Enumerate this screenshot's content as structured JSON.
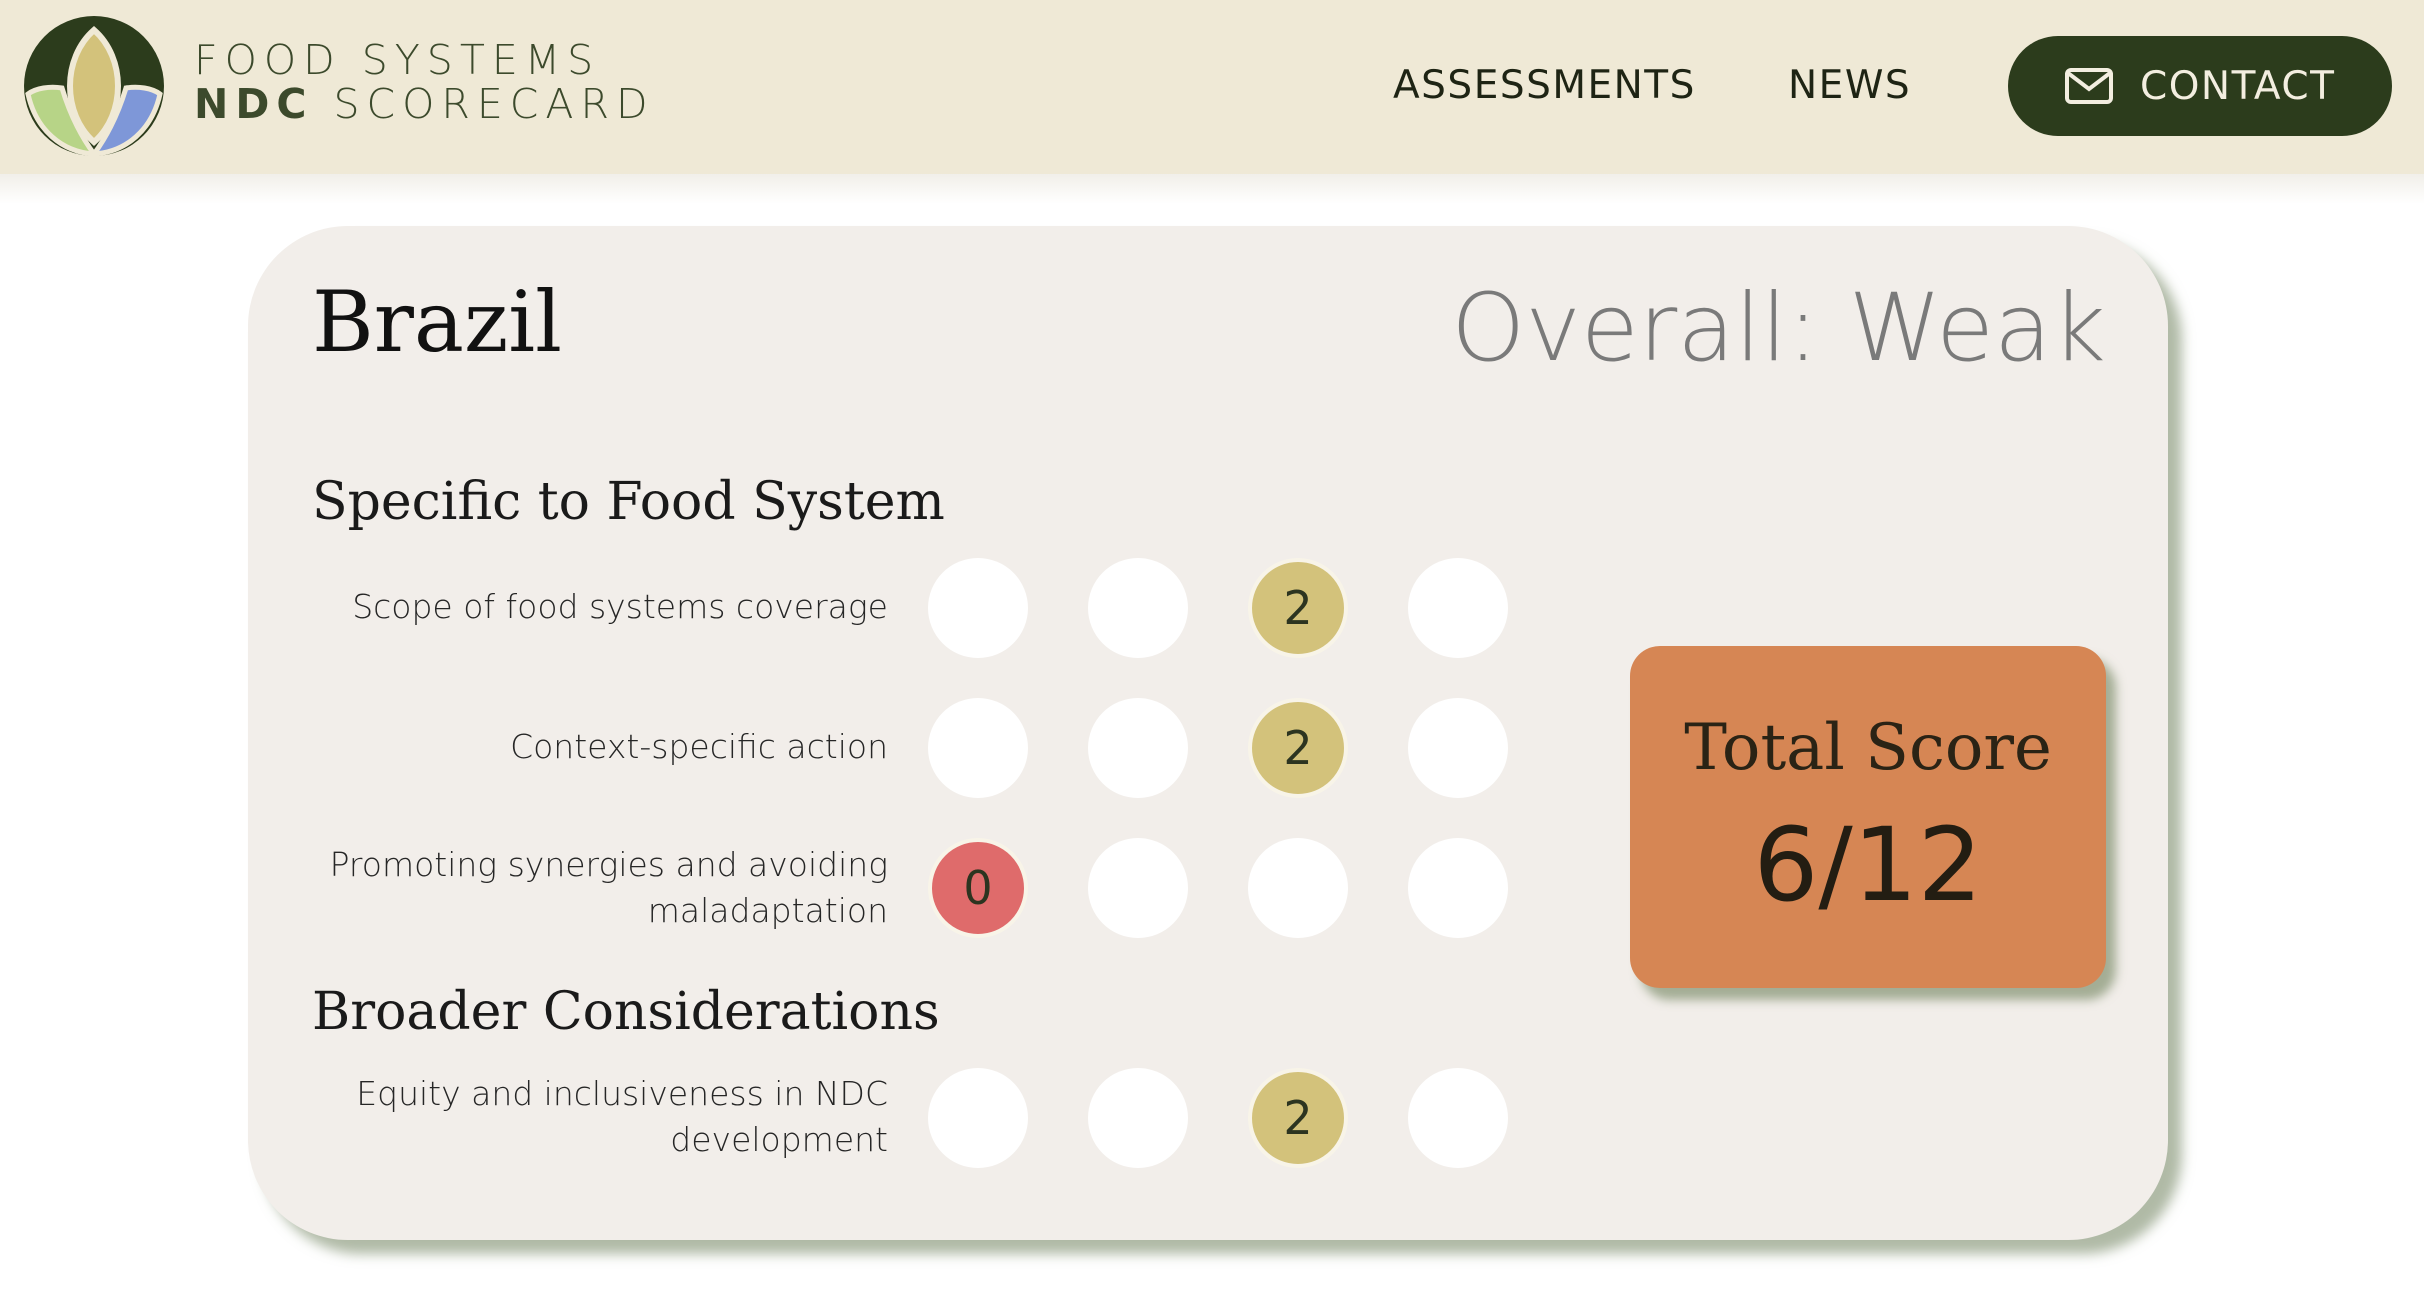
{
  "header": {
    "brand_line1": "FOOD SYSTEMS",
    "brand_line2_bold": "NDC",
    "brand_line2_rest": " SCORECARD",
    "nav": [
      {
        "label": "ASSESSMENTS"
      },
      {
        "label": "NEWS"
      }
    ],
    "contact_label": "CONTACT",
    "contact_icon": "envelope-icon"
  },
  "scorecard": {
    "country": "Brazil",
    "overall": "Overall: Weak",
    "sections": [
      {
        "title": "Specific to Food System",
        "criteria": [
          {
            "label": "Scope of food systems coverage",
            "score": "2",
            "score_index": 2
          },
          {
            "label": "Context-specific action",
            "score": "2",
            "score_index": 2
          },
          {
            "label": "Promoting synergies and avoiding maladaptation",
            "score": "0",
            "score_index": 0
          }
        ]
      },
      {
        "title": "Broader Considerations",
        "criteria": [
          {
            "label": "Equity and inclusiveness in NDC development",
            "score": "2",
            "score_index": 2
          }
        ]
      }
    ],
    "total": {
      "title": "Total Score",
      "value": "6/12"
    }
  },
  "colors": {
    "header_bg": "#efe9d6",
    "card_bg": "#f2eeea",
    "contact_bg": "#2c3c1c",
    "score_2": "#d3c27b",
    "score_0": "#df6b6b",
    "total_bg": "#d68654"
  }
}
